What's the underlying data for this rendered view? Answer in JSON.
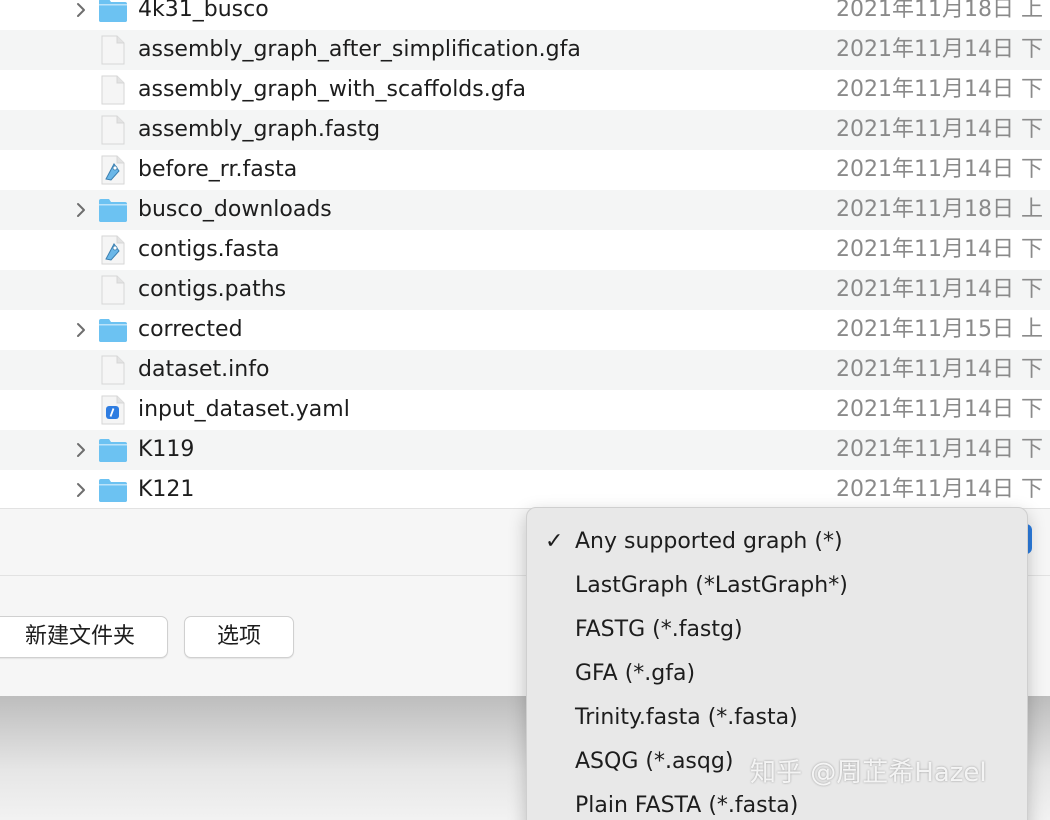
{
  "files": [
    {
      "name": "4k31_busco",
      "date": "2021年11月18日 上",
      "kind": "folder",
      "expandable": true,
      "alt": false,
      "icon": "folder-icon"
    },
    {
      "name": "assembly_graph_after_simplification.gfa",
      "date": "2021年11月14日 下",
      "kind": "doc",
      "expandable": false,
      "alt": true,
      "icon": "document-icon"
    },
    {
      "name": "assembly_graph_with_scaffolds.gfa",
      "date": "2021年11月14日 下",
      "kind": "doc",
      "expandable": false,
      "alt": false,
      "icon": "document-icon"
    },
    {
      "name": "assembly_graph.fastg",
      "date": "2021年11月14日 下",
      "kind": "doc",
      "expandable": false,
      "alt": true,
      "icon": "document-icon"
    },
    {
      "name": "before_rr.fasta",
      "date": "2021年11月14日 下",
      "kind": "fasta",
      "expandable": false,
      "alt": false,
      "icon": "fasta-file-icon"
    },
    {
      "name": "busco_downloads",
      "date": "2021年11月18日 上",
      "kind": "folder",
      "expandable": true,
      "alt": true,
      "icon": "folder-icon"
    },
    {
      "name": "contigs.fasta",
      "date": "2021年11月14日 下",
      "kind": "fasta",
      "expandable": false,
      "alt": false,
      "icon": "fasta-file-icon"
    },
    {
      "name": "contigs.paths",
      "date": "2021年11月14日 下",
      "kind": "doc",
      "expandable": false,
      "alt": true,
      "icon": "document-icon"
    },
    {
      "name": "corrected",
      "date": "2021年11月15日 上",
      "kind": "folder",
      "expandable": true,
      "alt": false,
      "icon": "folder-icon"
    },
    {
      "name": "dataset.info",
      "date": "2021年11月14日 下",
      "kind": "doc",
      "expandable": false,
      "alt": true,
      "icon": "document-icon"
    },
    {
      "name": "input_dataset.yaml",
      "date": "2021年11月14日 下",
      "kind": "yaml",
      "expandable": false,
      "alt": false,
      "icon": "yaml-file-icon"
    },
    {
      "name": "K119",
      "date": "2021年11月14日 下",
      "kind": "folder",
      "expandable": true,
      "alt": true,
      "icon": "folder-icon"
    },
    {
      "name": "K121",
      "date": "2021年11月14日 下",
      "kind": "folder",
      "expandable": true,
      "alt": false,
      "icon": "folder-icon"
    }
  ],
  "buttons": {
    "new_folder": "新建文件夹",
    "options": "选项"
  },
  "format_menu": {
    "selected": "Any supported graph (*)",
    "items": [
      {
        "label": "Any supported graph (*)",
        "checked": true
      },
      {
        "label": "LastGraph (*LastGraph*)",
        "checked": false
      },
      {
        "label": "FASTG (*.fastg)",
        "checked": false
      },
      {
        "label": "GFA (*.gfa)",
        "checked": false
      },
      {
        "label": "Trinity.fasta (*.fasta)",
        "checked": false
      },
      {
        "label": "ASQG (*.asqg)",
        "checked": false
      },
      {
        "label": "Plain FASTA (*.fasta)",
        "checked": false
      }
    ],
    "check_glyph": "✓"
  },
  "watermark": "知乎 @周芷希Hazel",
  "colors": {
    "folder": "#6cc2f2",
    "accent": "#2c7de0",
    "row_alt": "#f4f5f5",
    "date_text": "#8a8a8a"
  }
}
